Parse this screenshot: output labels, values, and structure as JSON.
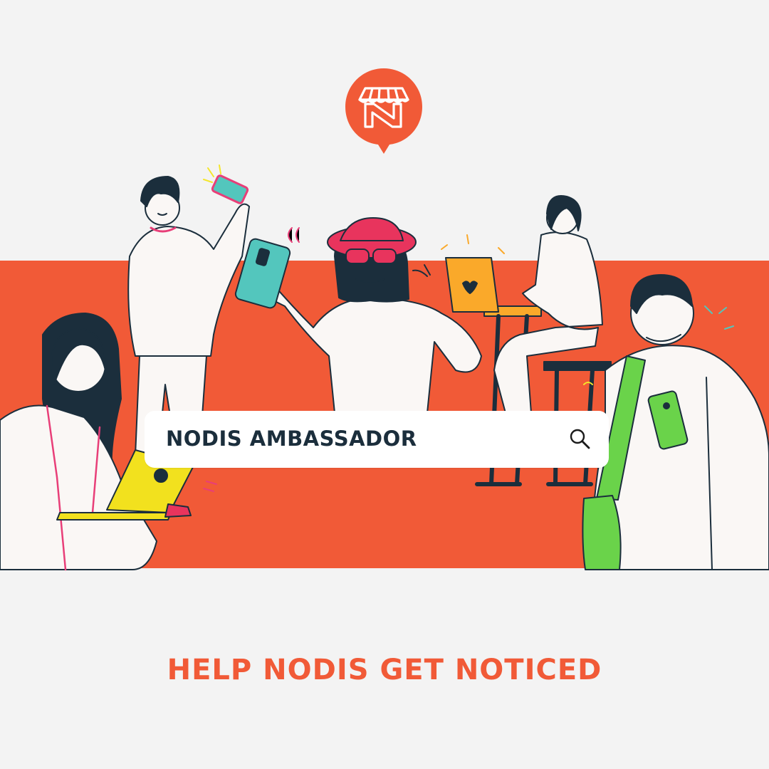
{
  "brand": {
    "logo_icon": "nodis-storefront-logo-icon",
    "accent_color": "#f15a37",
    "dark_color": "#1b2e3c"
  },
  "search": {
    "query": "NODIS AMBASSADOR",
    "icon": "search-icon"
  },
  "tagline": "HELP NODIS GET NOTICED"
}
